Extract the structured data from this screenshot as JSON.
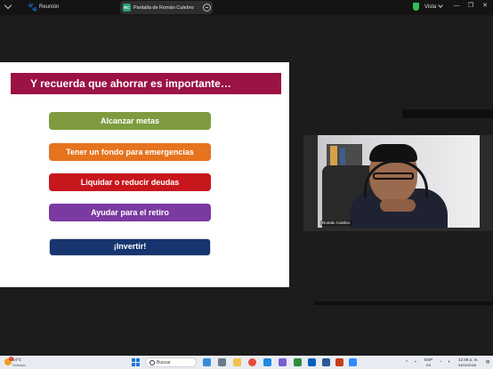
{
  "topbar": {
    "meeting_title": "Reunión",
    "share_label": "Pantalla de Román Culebro",
    "share_avatar": "RC",
    "view_label": "Vista",
    "window_buttons": [
      "—",
      "❐",
      "✕"
    ]
  },
  "slide": {
    "title": "Y recuerda que ahorrar es importante…",
    "items": [
      {
        "label": "Alcanzar metas",
        "color": "#7e9b3f"
      },
      {
        "label": "Tener un fondo para emergencias",
        "color": "#e6731e"
      },
      {
        "label": "Liquidar o reducir deudas",
        "color": "#c8161d"
      },
      {
        "label": "Ayudar para el retiro",
        "color": "#7b3aa1"
      },
      {
        "label": "¡Invertir!",
        "color": "#16356f"
      }
    ],
    "title_color": "#9b1244"
  },
  "video": {
    "participant_name": "Román Culebro"
  },
  "taskbar": {
    "weather_temp": "24°C",
    "weather_desc": "Soleado",
    "weather_badge": "1",
    "search_placeholder": "Buscar",
    "lang": "ESP",
    "lang_sub": "ES",
    "time": "12:48 p. m.",
    "date": "04/02/2026"
  },
  "icons": [
    "paw-icon",
    "shield-icon",
    "search-icon",
    "windows-start-icon"
  ]
}
